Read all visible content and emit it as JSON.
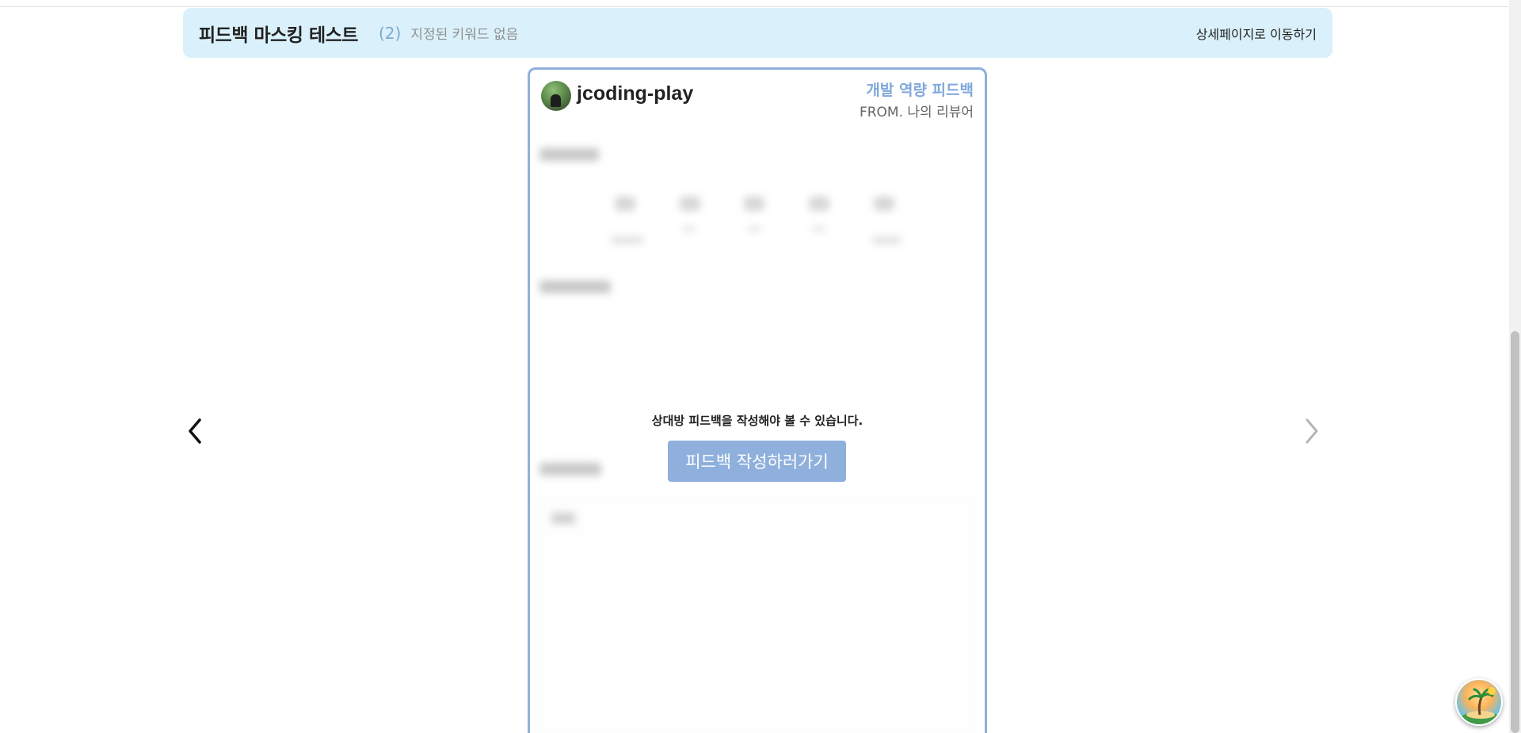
{
  "header": {
    "title": "피드백 마스킹 테스트",
    "count": "(2)",
    "keyword_status": "지정된 키워드 없음",
    "detail_link": "상세페이지로 이동하기"
  },
  "card": {
    "username": "jcoding-play",
    "feedback_type": "개발 역량 피드백",
    "from_label": "FROM. 나의 리뷰어",
    "lock_message": "상대방 피드백을 작성해야 볼 수 있습니다.",
    "lock_button": "피드백 작성하러가기"
  },
  "colors": {
    "header_bg": "#daf1fb",
    "accent": "#8fb0dc",
    "accent_text": "#7fa8dc"
  },
  "icons": {
    "prev": "chevron-left-icon",
    "next": "chevron-right-icon",
    "badge": "island-badge-icon"
  }
}
